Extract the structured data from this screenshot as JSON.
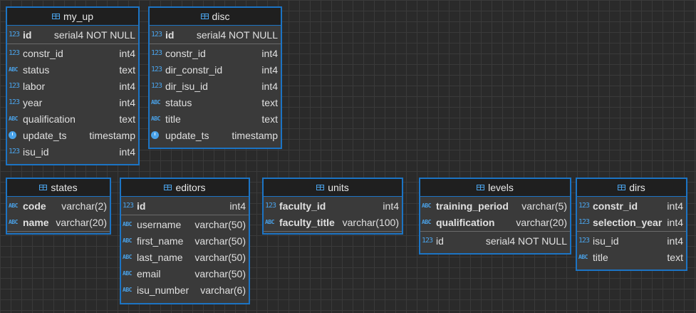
{
  "entities": {
    "my_up": {
      "title": "my_up",
      "keys": [
        {
          "icon": "123",
          "name": "id",
          "type": "serial4 NOT NULL"
        }
      ],
      "fields": [
        {
          "icon": "123",
          "name": "constr_id",
          "type": "int4"
        },
        {
          "icon": "ABC",
          "name": "status",
          "type": "text"
        },
        {
          "icon": "123",
          "name": "labor",
          "type": "int4"
        },
        {
          "icon": "123",
          "name": "year",
          "type": "int4"
        },
        {
          "icon": "ABC",
          "name": "qualification",
          "type": "text"
        },
        {
          "icon": "clock",
          "name": "update_ts",
          "type": "timestamp"
        },
        {
          "icon": "123",
          "name": "isu_id",
          "type": "int4"
        }
      ]
    },
    "disc": {
      "title": "disc",
      "keys": [
        {
          "icon": "123",
          "name": "id",
          "type": "serial4 NOT NULL"
        }
      ],
      "fields": [
        {
          "icon": "123",
          "name": "constr_id",
          "type": "int4"
        },
        {
          "icon": "123",
          "name": "dir_constr_id",
          "type": "int4"
        },
        {
          "icon": "123",
          "name": "dir_isu_id",
          "type": "int4"
        },
        {
          "icon": "ABC",
          "name": "status",
          "type": "text"
        },
        {
          "icon": "ABC",
          "name": "title",
          "type": "text"
        },
        {
          "icon": "clock",
          "name": "update_ts",
          "type": "timestamp"
        }
      ]
    },
    "states": {
      "title": "states",
      "keys": [
        {
          "icon": "ABC",
          "name": "code",
          "type": "varchar(2)"
        },
        {
          "icon": "ABC",
          "name": "name",
          "type": "varchar(20)"
        }
      ],
      "fields": []
    },
    "editors": {
      "title": "editors",
      "keys": [
        {
          "icon": "123",
          "name": "id",
          "type": "int4"
        }
      ],
      "fields": [
        {
          "icon": "ABC",
          "name": "username",
          "type": "varchar(50)"
        },
        {
          "icon": "ABC",
          "name": "first_name",
          "type": "varchar(50)"
        },
        {
          "icon": "ABC",
          "name": "last_name",
          "type": "varchar(50)"
        },
        {
          "icon": "ABC",
          "name": "email",
          "type": "varchar(50)"
        },
        {
          "icon": "ABC",
          "name": "isu_number",
          "type": "varchar(6)"
        }
      ]
    },
    "units": {
      "title": "units",
      "keys": [
        {
          "icon": "123",
          "name": "faculty_id",
          "type": "int4"
        },
        {
          "icon": "ABC",
          "name": "faculty_title",
          "type": "varchar(100)"
        }
      ],
      "fields": []
    },
    "levels": {
      "title": "levels",
      "keys": [
        {
          "icon": "ABC",
          "name": "training_period",
          "type": "varchar(5)"
        },
        {
          "icon": "ABC",
          "name": "qualification",
          "type": "varchar(20)"
        }
      ],
      "fields": [
        {
          "icon": "123",
          "name": "id",
          "type": "serial4 NOT NULL"
        }
      ]
    },
    "dirs": {
      "title": "dirs",
      "keys": [
        {
          "icon": "123",
          "name": "constr_id",
          "type": "int4"
        },
        {
          "icon": "123",
          "name": "selection_year",
          "type": "int4"
        }
      ],
      "fields": [
        {
          "icon": "123",
          "name": "isu_id",
          "type": "int4"
        },
        {
          "icon": "ABC",
          "name": "title",
          "type": "text"
        }
      ]
    }
  }
}
